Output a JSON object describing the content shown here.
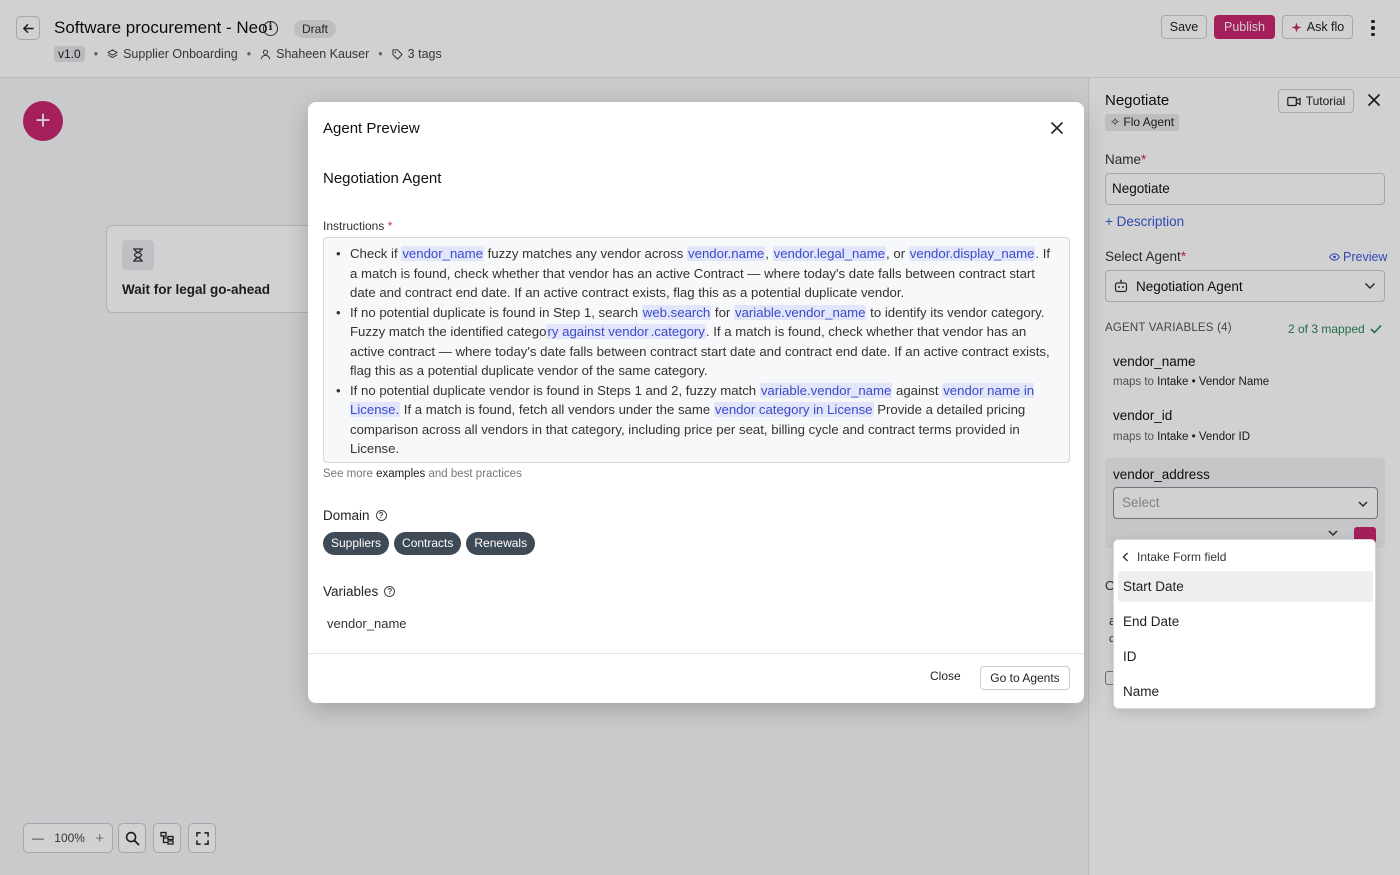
{
  "header": {
    "title": "Software procurement - Neo",
    "status": "Draft",
    "version": "v1.0",
    "process": "Supplier Onboarding",
    "owner": "Shaheen Kauser",
    "tags": "3 tags",
    "save_label": "Save",
    "publish_label": "Publish",
    "ask_label": "Ask flo"
  },
  "canvas": {
    "node_label": "Wait for legal go-ahead",
    "zoom_level": "100%"
  },
  "panel": {
    "title": "Negotiate",
    "tutorial_label": "Tutorial",
    "badge": "Flo Agent",
    "name_label": "Name",
    "name_value": "Negotiate",
    "description_link": "+ Description",
    "select_agent_label": "Select Agent",
    "preview_link": "Preview",
    "selected_agent": "Negotiation Agent",
    "vars_title": "AGENT VARIABLES (4)",
    "mapped_status": "2 of 3 mapped",
    "maps_to_prefix": "maps to",
    "variables": [
      {
        "name": "vendor_name",
        "maps_to": "Intake • Vendor Name"
      },
      {
        "name": "vendor_id",
        "maps_to": "Intake • Vendor ID"
      },
      {
        "name": "vendor_address",
        "placeholder": "Select"
      }
    ]
  },
  "modal": {
    "title": "Agent Preview",
    "agent_name": "Negotiation Agent",
    "instructions_label": "Instructions",
    "see_more_prefix": "See more",
    "see_more_link": "examples",
    "see_more_suffix": "and best practices",
    "domain_label": "Domain",
    "domains": [
      "Suppliers",
      "Contracts",
      "Renewals"
    ],
    "variables_label": "Variables",
    "variable": "vendor_name",
    "close_label": "Close",
    "goto_label": "Go to Agents",
    "instructions": {
      "b1_t1": "Check if",
      "b1_k1": "vendor_name",
      "b1_t2": "fuzzy matches any vendor across",
      "b1_k2": "vendor.name",
      "b1_k3": "vendor.legal_name",
      "b1_t3": ", or",
      "b1_k4": "vendor.display_name",
      "b1_t4": ". If a match is found, check whether that vendor has an active Contract — where today's date falls between contract start date and contract end date. If an active contract exists, flag this as a potential duplicate vendor.",
      "b2_t1": "If no potential duplicate is found in Step 1, search",
      "b2_k1": "web.search",
      "b2_t2": "for",
      "b2_k2": "variable.vendor_name",
      "b2_t3": "to identify its vendor category. Fuzzy match the identified catego",
      "b2_k3": "ry against vendor",
      "b2_k4": ".category",
      "b2_t4": ". If a match is found, check whether that vendor has an active contract — where today's date falls between contract start date and contract end date. If an active contract exists, flag this as a potential duplicate vendor of the same category.",
      "b3_t1": "If no potential duplicate vendor is found in Steps 1 and 2, fuzzy match",
      "b3_k1": "variable.vendor_name",
      "b3_t2": "against",
      "b3_k2": "vendor name in License.",
      "b3_t3": "If a match is found, fetch all vendors under the same",
      "b3_k3": "vendor category in License",
      "b3_t4": "Provide a detailed pricing comparison across all vendors in that category, including price per seat, billing cycle and contract terms provided in License."
    }
  },
  "dropdown": {
    "header": "Intake Form field",
    "options": [
      "Start Date",
      "End Date",
      "ID",
      "Name"
    ]
  },
  "colors": {
    "brand": "#c8276f",
    "link": "#3b5bdb",
    "success": "#2f855a",
    "chip": "#3f4a57"
  }
}
